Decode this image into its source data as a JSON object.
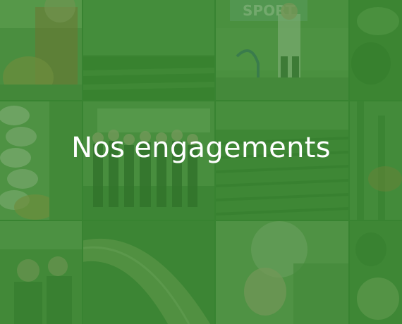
{
  "banner": {
    "title": "Nos engagements",
    "overlay_color": "#34802c"
  },
  "tiles": [
    {
      "id": "tile-child-with-melon",
      "subject": "child holding a melon"
    },
    {
      "id": "tile-green-field",
      "subject": "crop field"
    },
    {
      "id": "tile-sport-event",
      "subject": "children at sport event"
    },
    {
      "id": "tile-plant-top-right",
      "subject": "plant close-up"
    },
    {
      "id": "tile-onions",
      "subject": "onions in crate"
    },
    {
      "id": "tile-group-photo",
      "subject": "group of people"
    },
    {
      "id": "tile-field-rows",
      "subject": "field rows"
    },
    {
      "id": "tile-plants-right",
      "subject": "plants"
    },
    {
      "id": "tile-grass-people",
      "subject": "people in grass"
    },
    {
      "id": "tile-leek",
      "subject": "leek close-up"
    },
    {
      "id": "tile-child-face",
      "subject": "child portrait"
    },
    {
      "id": "tile-vegetable-bottom-right",
      "subject": "vegetable close-up"
    }
  ]
}
